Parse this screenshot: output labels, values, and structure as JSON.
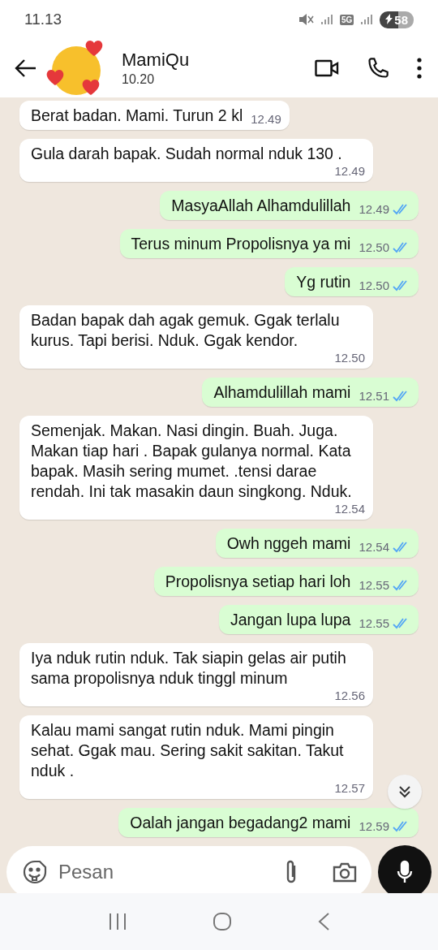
{
  "status_bar": {
    "time": "11.13",
    "network": "5G",
    "battery": "58"
  },
  "header": {
    "name": "MamiQu",
    "status": "10.20"
  },
  "messages": [
    {
      "kind": "in",
      "text": "Berat badan. Mami. Turun 2 kl",
      "time": "12.49"
    },
    {
      "kind": "in",
      "text": "Gula darah bapak. Sudah normal nduk 130 .",
      "time": "12.49"
    },
    {
      "kind": "out",
      "text": "MasyaAllah Alhamdulillah",
      "time": "12.49",
      "read": true
    },
    {
      "kind": "out",
      "text": "Terus minum Propolisnya ya mi",
      "time": "12.50",
      "read": true
    },
    {
      "kind": "out",
      "text": "Yg rutin",
      "time": "12.50",
      "read": true
    },
    {
      "kind": "in",
      "text": "Badan bapak dah agak gemuk. Ggak terlalu kurus. Tapi berisi. Nduk. Ggak kendor.",
      "time": "12.50"
    },
    {
      "kind": "out",
      "text": "Alhamdulillah mami",
      "time": "12.51",
      "read": true
    },
    {
      "kind": "in",
      "text": "Semenjak. Makan. Nasi dingin.  Buah. Juga. Makan tiap hari . Bapak gulanya normal.  Kata bapak. Masih sering mumet.  .tensi darae rendah.   Ini tak masakin daun singkong. Nduk.",
      "time": "12.54"
    },
    {
      "kind": "out",
      "text": "Owh nggeh mami",
      "time": "12.54",
      "read": true
    },
    {
      "kind": "out",
      "text": "Propolisnya setiap hari loh",
      "time": "12.55",
      "read": true
    },
    {
      "kind": "out",
      "text": "Jangan lupa lupa",
      "time": "12.55",
      "read": true
    },
    {
      "kind": "in",
      "text": "Iya nduk rutin nduk. Tak siapin gelas air putih sama propolisnya nduk tinggl minum",
      "time": "12.56"
    },
    {
      "kind": "in",
      "text": "Kalau mami sangat rutin nduk. Mami pingin sehat. Ggak mau. Sering sakit sakitan. Takut nduk .",
      "time": "12.57"
    },
    {
      "kind": "out",
      "text": "Oalah jangan begadang2 mami",
      "time": "12.59",
      "read": true
    }
  ],
  "composer": {
    "placeholder": "Pesan"
  }
}
